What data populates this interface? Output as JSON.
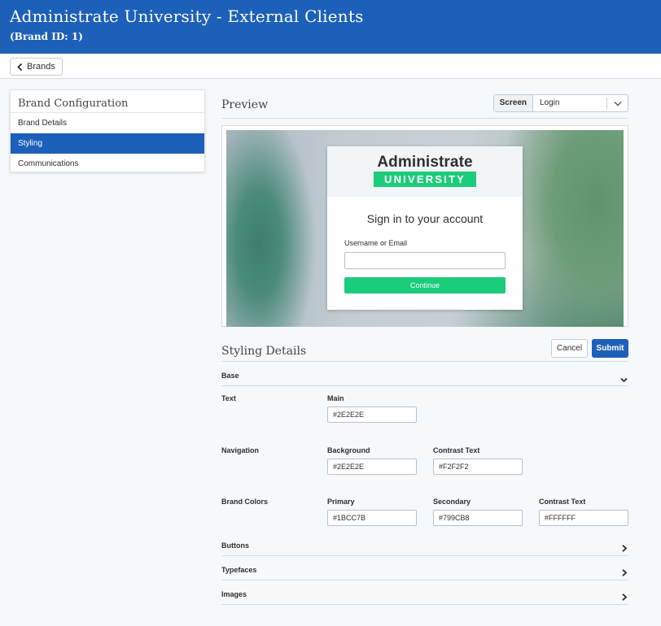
{
  "header": {
    "title": "Administrate University - External Clients",
    "subtitle": "(Brand ID: 1)"
  },
  "toolbar": {
    "back_label": "Brands"
  },
  "sidebar": {
    "title": "Brand Configuration",
    "items": [
      {
        "label": "Brand Details",
        "active": false
      },
      {
        "label": "Styling",
        "active": true
      },
      {
        "label": "Communications",
        "active": false
      }
    ]
  },
  "preview": {
    "title": "Preview",
    "screen_label": "Screen",
    "screen_value": "Login",
    "login": {
      "logo_top": "Administrate",
      "logo_bottom": "UNIVERSITY",
      "heading": "Sign in to your account",
      "field_label": "Username or Email",
      "field_value": "",
      "button_label": "Continue"
    }
  },
  "styling": {
    "title": "Styling Details",
    "cancel_label": "Cancel",
    "submit_label": "Submit",
    "sections": {
      "base": {
        "label": "Base",
        "expanded": true
      },
      "buttons": {
        "label": "Buttons",
        "expanded": false
      },
      "typefaces": {
        "label": "Typefaces",
        "expanded": false
      },
      "images": {
        "label": "Images",
        "expanded": false
      }
    },
    "text": {
      "label": "Text",
      "main_label": "Main",
      "main_value": "#2E2E2E"
    },
    "navigation": {
      "label": "Navigation",
      "background_label": "Background",
      "background_value": "#2E2E2E",
      "contrast_label": "Contrast Text",
      "contrast_value": "#F2F2F2"
    },
    "brand_colors": {
      "label": "Brand Colors",
      "primary_label": "Primary",
      "primary_value": "#1BCC7B",
      "secondary_label": "Secondary",
      "secondary_value": "#799CB8",
      "contrast_label": "Contrast Text",
      "contrast_value": "#FFFFFF"
    }
  },
  "colors": {
    "brand_blue": "#1D60B9",
    "accent_green": "#1BCC7B"
  }
}
